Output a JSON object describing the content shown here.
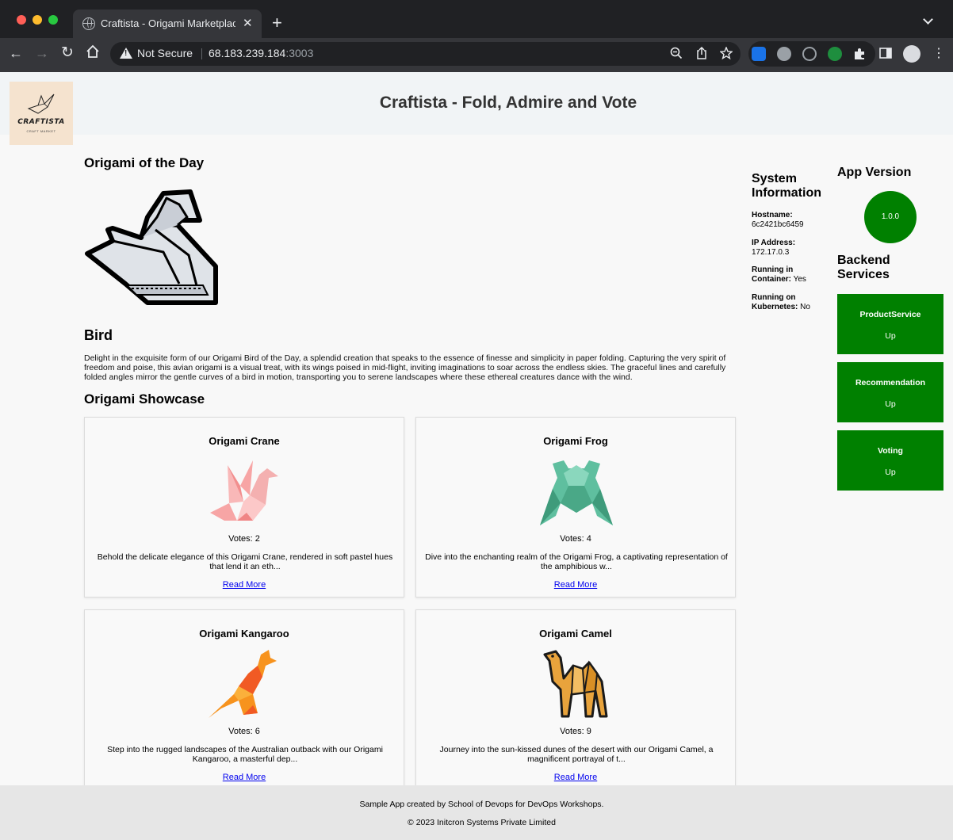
{
  "browser": {
    "tab_title": "Craftista - Origami Marketplace",
    "not_secure_label": "Not Secure",
    "url_host": "68.183.239.184",
    "url_port": ":3003"
  },
  "header": {
    "logo_text": "CRAFTISTA",
    "logo_subtext": "CRAFT MARKET",
    "title": "Craftista - Fold, Admire and Vote"
  },
  "origami_of_the_day": {
    "heading": "Origami of the Day",
    "name": "Bird",
    "description": "Delight in the exquisite form of our Origami Bird of the Day, a splendid creation that speaks to the essence of finesse and simplicity in paper folding. Capturing the very spirit of freedom and poise, this avian origami is a visual treat, with its wings poised in mid-flight, inviting imaginations to soar across the endless skies. The graceful lines and carefully folded angles mirror the gentle curves of a bird in motion, transporting you to serene landscapes where these ethereal creatures dance with the wind."
  },
  "showcase": {
    "heading": "Origami Showcase",
    "items": [
      {
        "title": "Origami Crane",
        "votes": "Votes: 2",
        "description": "Behold the delicate elegance of this Origami Crane, rendered in soft pastel hues that lend it an eth...",
        "link": "Read More",
        "icon": "crane-icon"
      },
      {
        "title": "Origami Frog",
        "votes": "Votes: 4",
        "description": "Dive into the enchanting realm of the Origami Frog, a captivating representation of the amphibious w...",
        "link": "Read More",
        "icon": "frog-icon"
      },
      {
        "title": "Origami Kangaroo",
        "votes": "Votes: 6",
        "description": "Step into the rugged landscapes of the Australian outback with our Origami Kangaroo, a masterful dep...",
        "link": "Read More",
        "icon": "kangaroo-icon"
      },
      {
        "title": "Origami Camel",
        "votes": "Votes: 9",
        "description": "Journey into the sun-kissed dunes of the desert with our Origami Camel, a magnificent portrayal of t...",
        "link": "Read More",
        "icon": "camel-icon"
      }
    ]
  },
  "system_info": {
    "heading": "System Information",
    "hostname_label": "Hostname:",
    "hostname": "6c2421bc6459",
    "ip_label": "IP Address:",
    "ip": "172.17.0.3",
    "container_label": "Running in Container:",
    "container": "Yes",
    "k8s_label": "Running on Kubernetes:",
    "k8s": "No"
  },
  "app_version": {
    "heading": "App Version",
    "version": "1.0.0"
  },
  "backend": {
    "heading": "Backend Services",
    "services": [
      {
        "name": "ProductService",
        "status": "Up"
      },
      {
        "name": "Recommendation",
        "status": "Up"
      },
      {
        "name": "Voting",
        "status": "Up"
      }
    ]
  },
  "footer": {
    "line1": "Sample App created by School of Devops for DevOps Workshops.",
    "line2": "© 2023 Initcron Systems Private Limited"
  },
  "colors": {
    "service_up": "#008000",
    "link": "#0000ee"
  }
}
